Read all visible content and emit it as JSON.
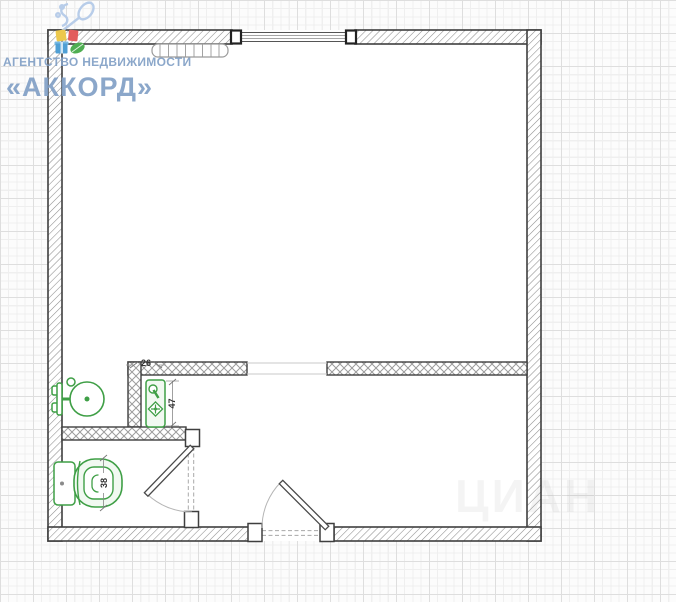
{
  "watermark": {
    "agency_line": "АГЕНТСТВО НЕДВИЖИМОСТИ",
    "agency_name": "«АККОРД»",
    "faint_text": "ЦИАН",
    "text_color": "#82a0c6",
    "icons": [
      "kitchen-utensils-icon",
      "yellow-note-icon",
      "red-tag-icon",
      "gift-box-icon",
      "leaf-icon"
    ]
  },
  "floorplan": {
    "dimensions": {
      "niche_width": "26",
      "fixture_depth": "47",
      "toilet_width": "38"
    },
    "fixtures": [
      "radiator",
      "window",
      "washbasin",
      "shower-tray",
      "toilet",
      "interior-door",
      "entrance-door",
      "wall-opening"
    ],
    "colors": {
      "fixture_green": "#3f9f46",
      "wall_outline": "#3f3f3f",
      "hatch_line": "#8d8d8d",
      "grid_minor": "#efefef",
      "grid_major": "#dedede"
    }
  }
}
